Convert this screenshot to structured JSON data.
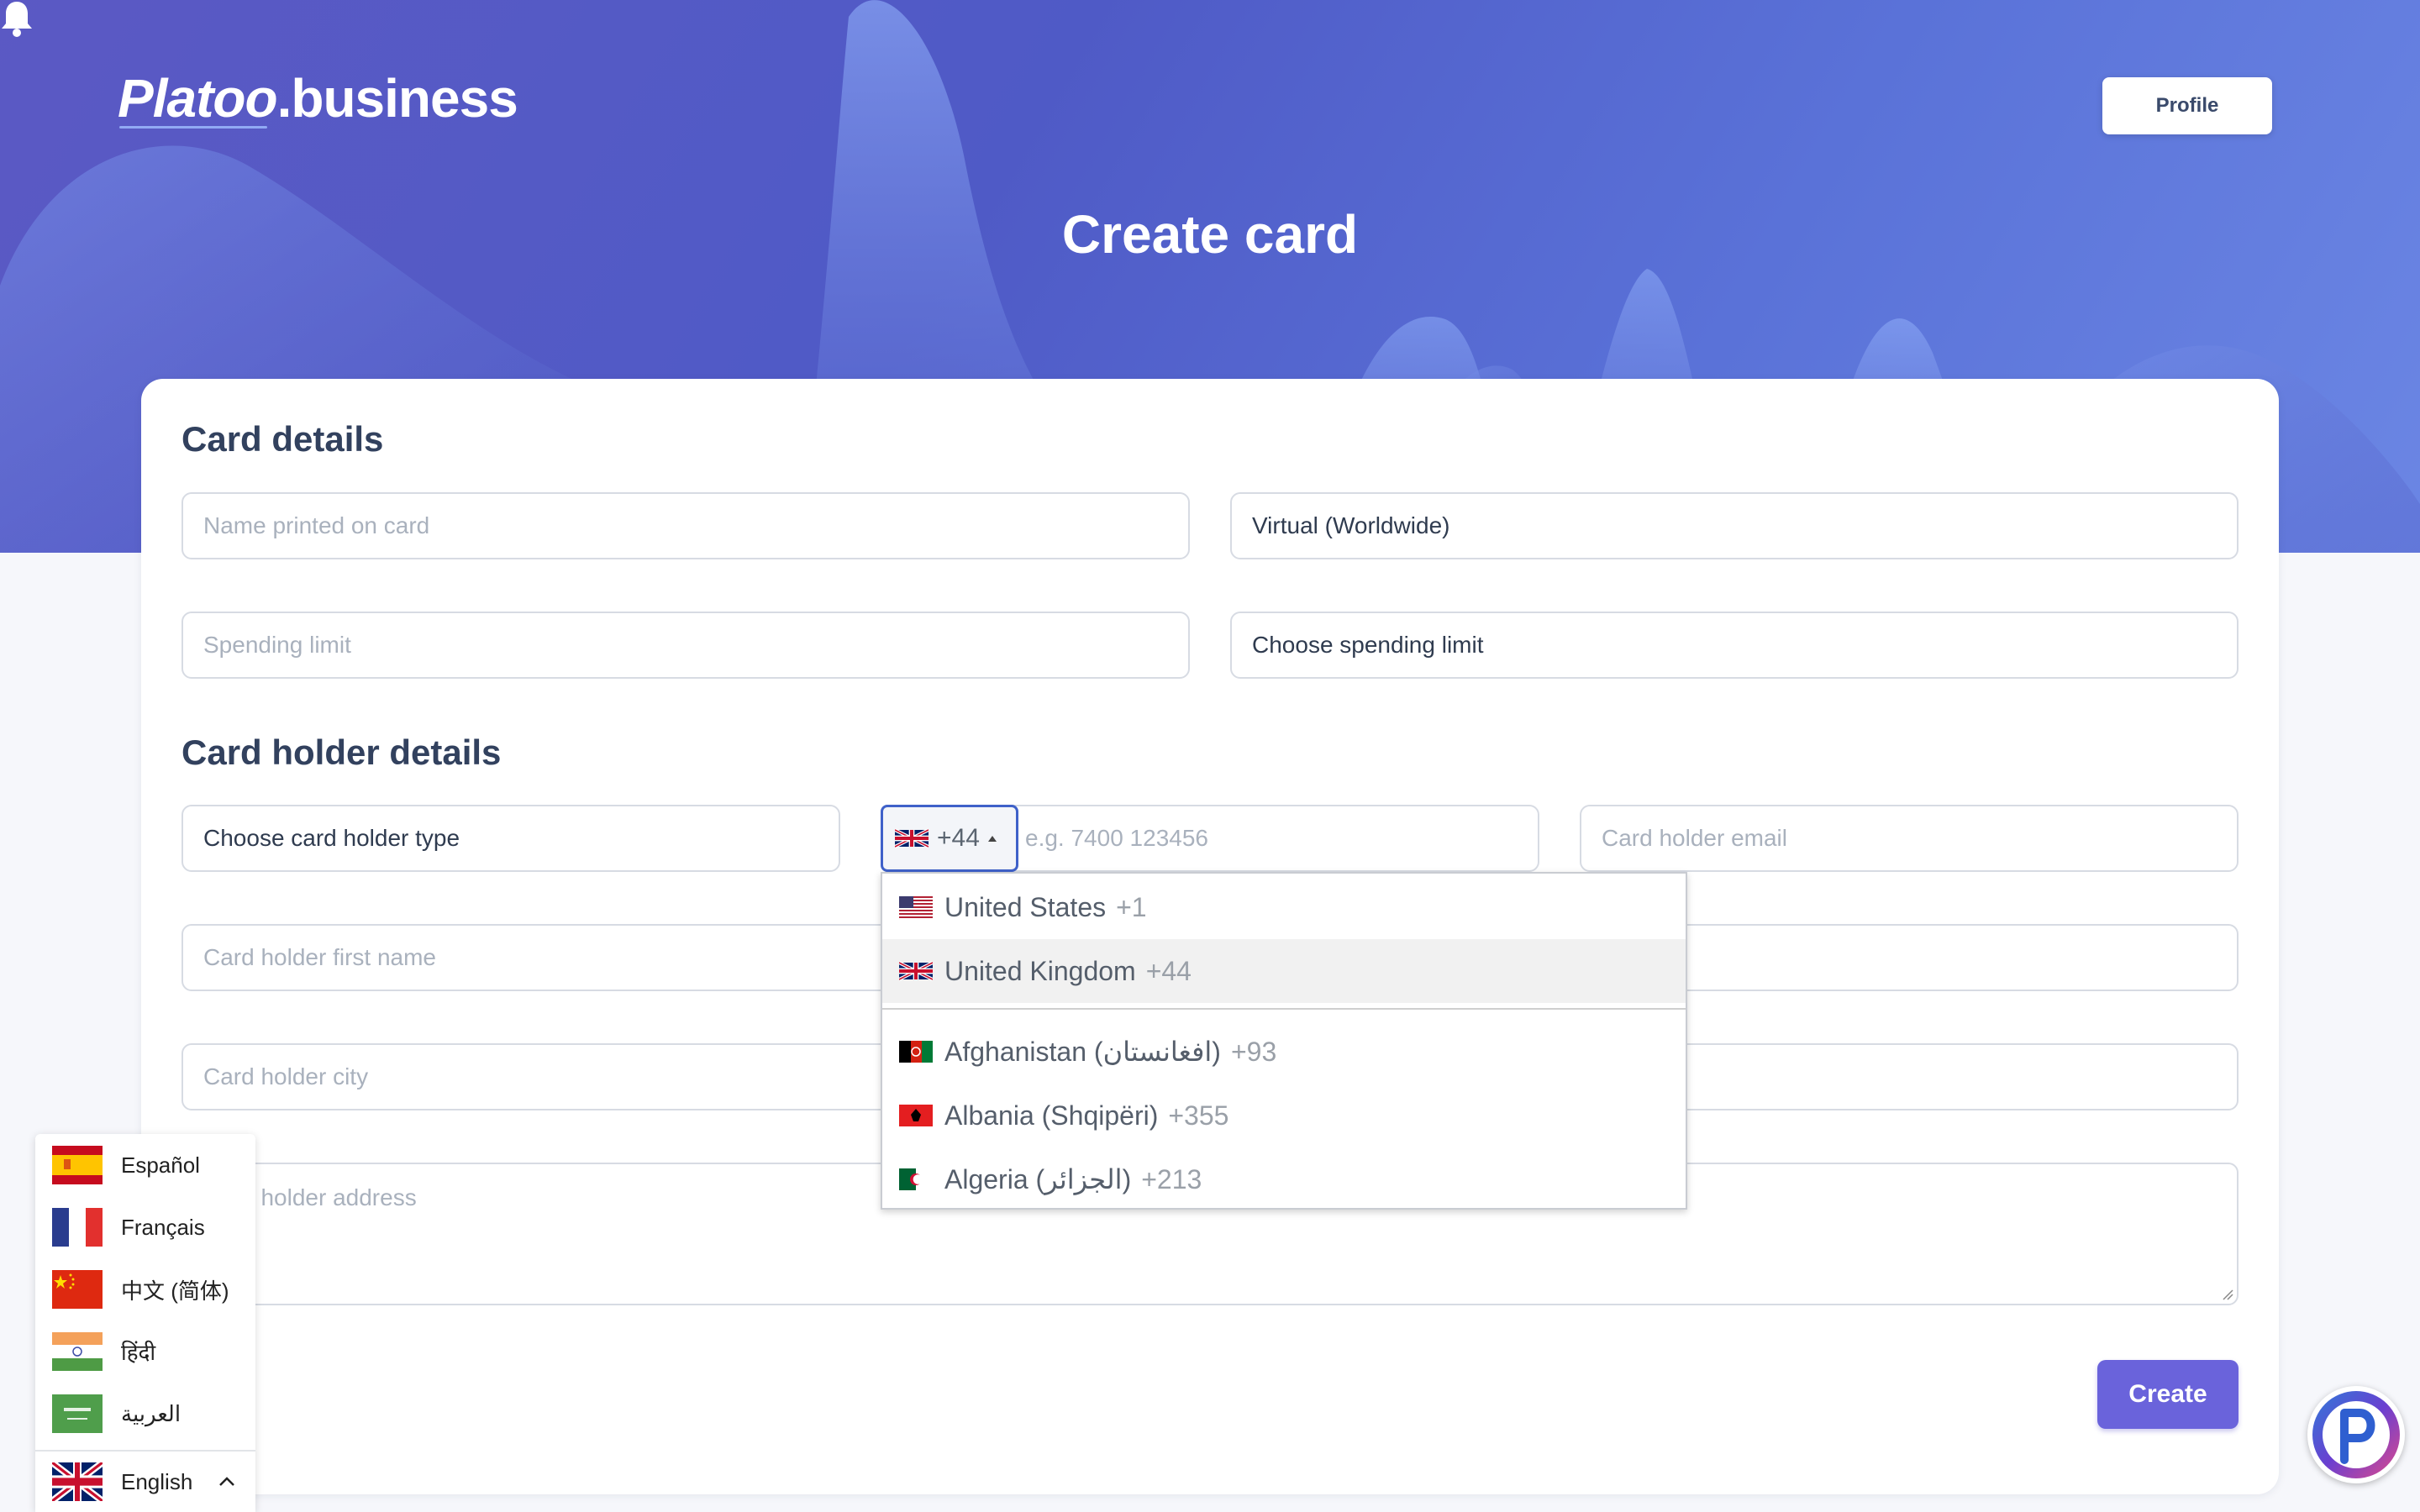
{
  "header": {
    "logo_part1": "Platoo",
    "logo_part2": ".business",
    "profile_label": "Profile",
    "page_title": "Create card"
  },
  "card_details": {
    "title": "Card details",
    "name_placeholder": "Name printed on card",
    "card_type_value": "Virtual (Worldwide)",
    "spending_limit_placeholder": "Spending limit",
    "spending_limit_period_value": "Choose spending limit"
  },
  "holder_details": {
    "title": "Card holder details",
    "holder_type_value": "Choose card holder type",
    "phone_code": "+44",
    "phone_placeholder": "e.g. 7400 123456",
    "email_placeholder": "Card holder email",
    "first_name_placeholder": "Card holder first name",
    "city_placeholder": "Card holder city",
    "address_placeholder": "Card holder address"
  },
  "country_dropdown": {
    "items": [
      {
        "name": "United States",
        "dial": "+1",
        "flag": "us-flag"
      },
      {
        "name": "United Kingdom",
        "dial": "+44",
        "flag": "gb-flag"
      },
      {
        "name": "Afghanistan (‫افغانستان‬‎)",
        "dial": "+93",
        "flag": "af-flag"
      },
      {
        "name": "Albania (Shqipëri)",
        "dial": "+355",
        "flag": "al-flag"
      },
      {
        "name": "Algeria (‫الجزائر‬‎)",
        "dial": "+213",
        "flag": "dz-flag"
      }
    ]
  },
  "actions": {
    "create_label": "Create"
  },
  "language_switcher": {
    "options": [
      {
        "label": "Español",
        "flag": "es-flag"
      },
      {
        "label": "Français",
        "flag": "fr-flag"
      },
      {
        "label": "中文 (简体)",
        "flag": "cn-flag"
      },
      {
        "label": "हिंदी",
        "flag": "in-flag"
      },
      {
        "label": "العربية",
        "flag": "sa-flag"
      }
    ],
    "current": "English"
  },
  "colors": {
    "hero_start": "#5b59c4",
    "hero_end": "#6b86e4",
    "accent": "#6a63db",
    "focus_border": "#3f61c9"
  }
}
